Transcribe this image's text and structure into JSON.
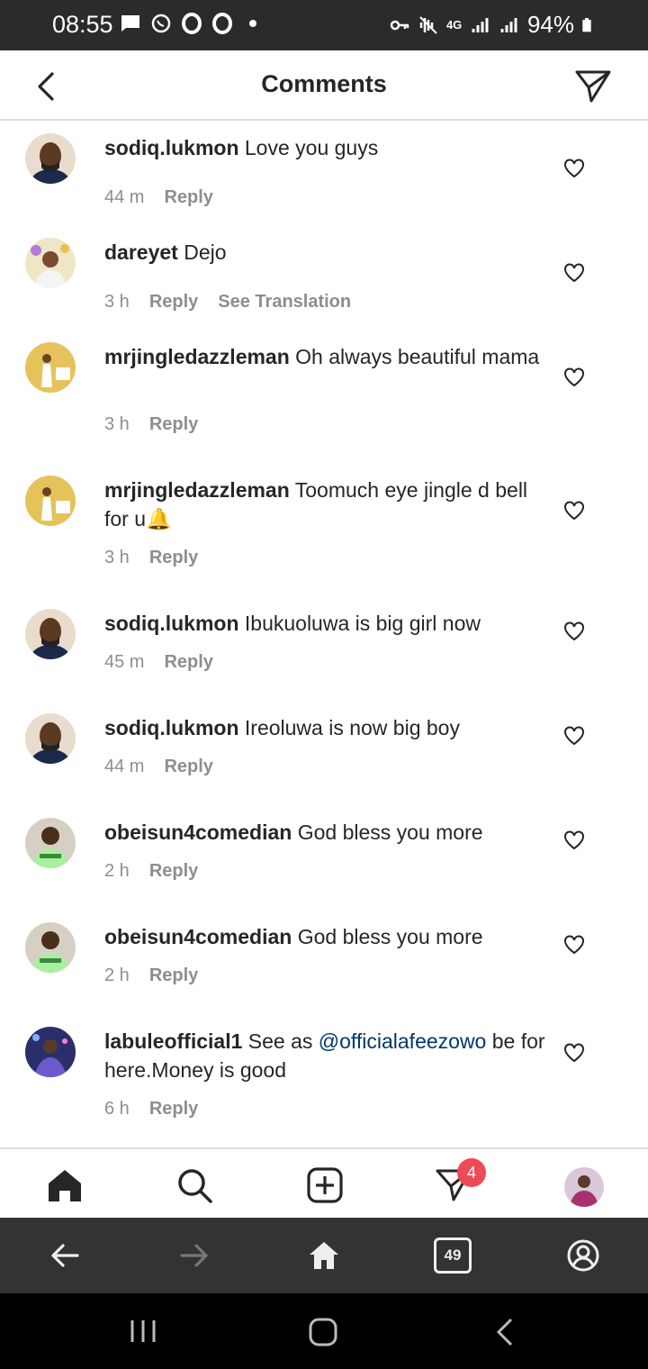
{
  "status_bar": {
    "time": "08:55",
    "battery": "94%",
    "network": "4G"
  },
  "header": {
    "title": "Comments"
  },
  "comments": [
    {
      "user": "sodiq.lukmon",
      "text": "Love you guys",
      "time": "44 m",
      "reply": "Reply"
    },
    {
      "user": "dareyet",
      "text": "Dejo",
      "time": "3 h",
      "reply": "Reply",
      "translate": "See Translation"
    },
    {
      "user": "mrjingledazzleman",
      "text": "Oh always beautiful mama",
      "time": "3 h",
      "reply": "Reply"
    },
    {
      "user": "mrjingledazzleman",
      "text": "Toomuch eye jingle d bell for u🔔",
      "time": "3 h",
      "reply": "Reply"
    },
    {
      "user": "sodiq.lukmon",
      "text": "Ibukuoluwa is big girl now",
      "time": "45 m",
      "reply": "Reply"
    },
    {
      "user": "sodiq.lukmon",
      "text": "Ireoluwa is now big boy",
      "time": "44 m",
      "reply": "Reply"
    },
    {
      "user": "obeisun4comedian",
      "text": "God bless you more",
      "time": "2 h",
      "reply": "Reply"
    },
    {
      "user": "obeisun4comedian",
      "text": "God bless you more",
      "time": "2 h",
      "reply": "Reply"
    },
    {
      "user": "labuleofficial1",
      "text_before": "See as",
      "mention": "@officialafeezowo",
      "text_after": "be for here.Money is good",
      "time": "6 h",
      "reply": "Reply"
    }
  ],
  "bottom_nav": {
    "activity_badge": "4"
  },
  "browser_bar": {
    "tab_count": "49"
  },
  "colors": {
    "text": "#262626",
    "secondary": "#8e8e8e",
    "mention": "#00376b",
    "badge": "#ed4956"
  }
}
